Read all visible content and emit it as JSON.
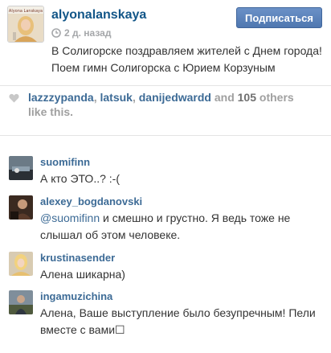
{
  "post": {
    "avatar_text": "Alyona Lanskaya",
    "username": "alyonalanskaya",
    "time": "2 д. назад",
    "follow_label": "Подписаться",
    "caption": "В Солигорске поздравляем жителей с Днем города! Поем гимн Солигорска с Юрием Корзуным"
  },
  "likes": {
    "users": [
      "lazzzypanda",
      "latsuk",
      "danijedwardd"
    ],
    "separator": ", ",
    "and": "and",
    "count": "105",
    "others": "others like this."
  },
  "comments": [
    {
      "user": "suomifinn",
      "text": "А кто ЭТО..? :-("
    },
    {
      "user": "alexey_bogdanovski",
      "mention": "@suomifinn",
      "text": " и смешно и грустно. Я ведь тоже не слышал об этом человеке."
    },
    {
      "user": "krustinasender",
      "text": "Алена шикарна)"
    },
    {
      "user": "ingamuzichina",
      "text": "Алена, Ваше выступление было безупречным! Пели вместе с вами☐"
    }
  ],
  "colors": {
    "link": "#3d6b96",
    "username": "#125688",
    "follow_button": "#5a80b8"
  },
  "icons": {
    "time": "clock-icon",
    "likes": "heart-icon"
  }
}
